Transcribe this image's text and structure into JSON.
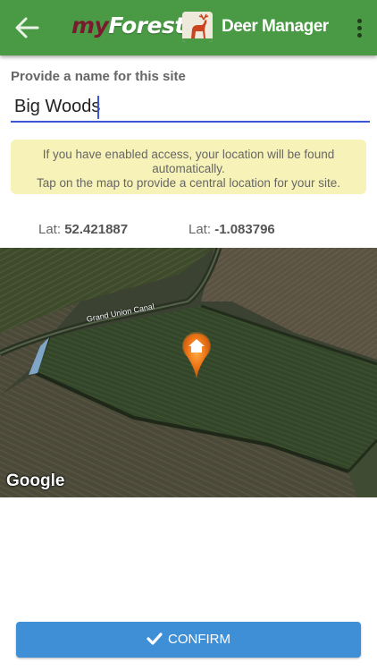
{
  "header": {
    "brand_my": "my",
    "brand_forest": "Forest",
    "app_title": "Deer Manager",
    "back_icon": "arrow-left-icon",
    "menu_icon": "more-vert-icon",
    "color": "#4a9a45"
  },
  "form": {
    "label": "Provide a name for this site",
    "site_name": "Big Woods"
  },
  "info": {
    "line1": "If you have enabled access, your location will be found",
    "line2": "automatically.",
    "line3": "Tap on the map to provide a central location for your site."
  },
  "location": {
    "lat_label": "Lat:",
    "lat_value": "52.421887",
    "lon_label": "Lat:",
    "lon_value": "-1.083796"
  },
  "map": {
    "canal_label": "Grand Union Canal",
    "attribution": "Google",
    "pin_icon": "home-pin-icon"
  },
  "actions": {
    "confirm_label": "CONFIRM",
    "confirm_icon": "check-icon",
    "confirm_color": "#3f8fd6"
  }
}
